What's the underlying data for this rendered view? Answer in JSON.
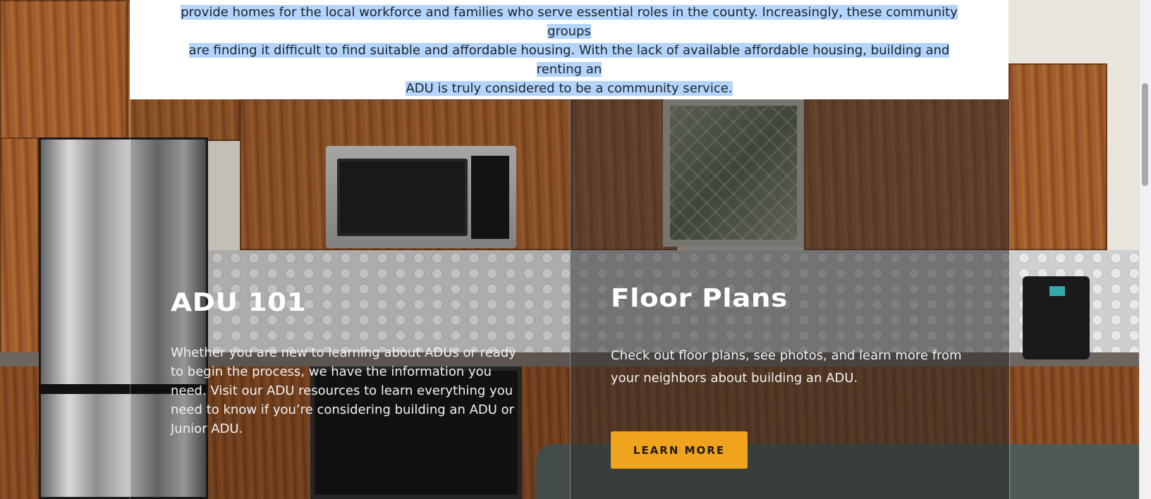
{
  "intro": {
    "line1": "provide homes for the local workforce and families who serve essential roles in the county. Increasingly, these community groups",
    "line2": "are finding it difficult to find suitable and affordable housing. With the lack of available affordable housing, building and renting an",
    "line3": "ADU is truly considered to be a community service."
  },
  "cards": [
    {
      "title": "ADU 101",
      "body": "Whether you are new to learning about ADUs or ready to begin the process, we have the information you need. Visit our ADU resources to learn everything you need to know if you’re considering building an ADU or Junior ADU."
    },
    {
      "title": "Floor Plans",
      "body": "Check out floor plans, see photos, and learn more from your neighbors about building an ADU.",
      "button_label": "LEARN MORE"
    }
  ],
  "colors": {
    "accent": "#f0a31c",
    "selection": "#b3d4fc"
  }
}
